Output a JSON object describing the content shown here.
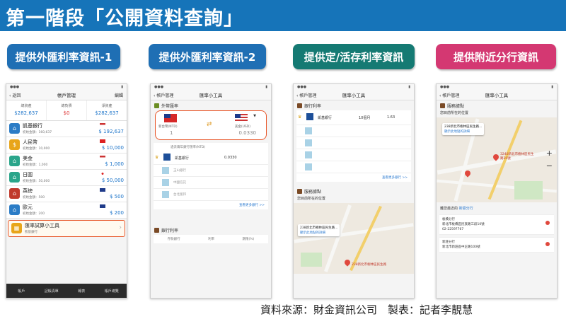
{
  "header": {
    "title": "第一階段「公開資料查詢」"
  },
  "pills": [
    {
      "label": "提供外匯利率資訊-1",
      "color": "#1f6fb4"
    },
    {
      "label": "提供外匯利率資訊-2",
      "color": "#1f6fb4"
    },
    {
      "label": "提供定/活存利率資訊",
      "color": "#157a73"
    },
    {
      "label": "提供附近分行資訊",
      "color": "#d43872"
    }
  ],
  "phone1": {
    "nav_back": "返回",
    "nav_title": "帳戶管理",
    "nav_right": "編輯",
    "summary": [
      {
        "label": "總資產",
        "value": "$282,637"
      },
      {
        "label": "總負債",
        "value": "$0"
      },
      {
        "label": "淨資產",
        "value": "$282,637"
      }
    ],
    "rows": [
      {
        "name": "凱基銀行",
        "sub": "初始金額：160,637",
        "amount": "$ 192,637",
        "icon": "bank-icon",
        "color": "#2b7cc6"
      },
      {
        "name": "人民幣",
        "sub": "初始金額：10,000",
        "amount": "$ 10,000",
        "icon": "dollar-icon",
        "color": "#e8a51a"
      },
      {
        "name": "美金",
        "sub": "初始金額：1,000",
        "amount": "$ 1,000",
        "icon": "bank-icon",
        "color": "#2aa58a"
      },
      {
        "name": "日圓",
        "sub": "初始金額：50,000",
        "amount": "$ 50,000",
        "icon": "bank-icon",
        "color": "#2aa58a"
      },
      {
        "name": "英鎊",
        "sub": "初始金額：500",
        "amount": "$ 500",
        "icon": "bank-icon",
        "color": "#c0392b"
      },
      {
        "name": "歐元",
        "sub": "初始金額：200",
        "amount": "$ 200",
        "icon": "bank-icon",
        "color": "#2b7cc6"
      }
    ],
    "calc": {
      "name": "匯率試算小工具",
      "sub": "凱基銀行"
    },
    "tabs": [
      "帳戶",
      "記帳清單",
      "報表",
      "帳戶總覽"
    ]
  },
  "phone2": {
    "nav_back": "帳戶管理",
    "nav_title": "匯率小工具",
    "section1": "外幣匯率",
    "from_label": "新台幣(NTD)",
    "from_value": "1",
    "to_label": "美金(USD)",
    "to_value": "0.0330",
    "table_head": "過去兩年銀行匯率(NTD)",
    "bank": "凱基銀行",
    "rate": "0.0330",
    "others": [
      "玉山銀行",
      "中國信託",
      "台北富邦"
    ],
    "more": "查看更多銀行 >>",
    "section2": "銀行利率",
    "bottom_cols": [
      "存款銀行",
      "利率",
      "期限(%)"
    ]
  },
  "phone3": {
    "nav_back": "帳戶管理",
    "nav_title": "匯率小工具",
    "section1": "銀行利率",
    "bank": "凱基銀行",
    "term": "10個月",
    "rate": "1.63",
    "more": "查看更多銀行 >>",
    "section2": "服務據點",
    "location_label": "您目前所在的位置",
    "bubble_title": "238新北市樹林區民生路...",
    "bubble_link": "顯示此地點的詳細",
    "map_label": "238新北市樹林區民生路"
  },
  "phone4": {
    "nav_back": "帳戶管理",
    "nav_title": "匯率小工具",
    "section1": "服務據點",
    "location_label": "您目前所在的位置",
    "bubble_title": "238新北市樹林區民生路...",
    "bubble_link": "顯示此地點的詳細",
    "store_label": "3240新北市樹林區民生路30號",
    "zoom_in": "+",
    "zoom_out": "−",
    "branch_header": "離您最近的",
    "branch_link": "新樹分行",
    "branches": [
      {
        "name": "板橋分行",
        "addr": "新北市板橋區民族路三段10號",
        "phone": "02-22597767"
      },
      {
        "name": "新莊分行",
        "addr": "新北市新莊區中正路100號"
      }
    ]
  },
  "source": "資料來源：財金資訊公司　製表：記者李靚慧"
}
